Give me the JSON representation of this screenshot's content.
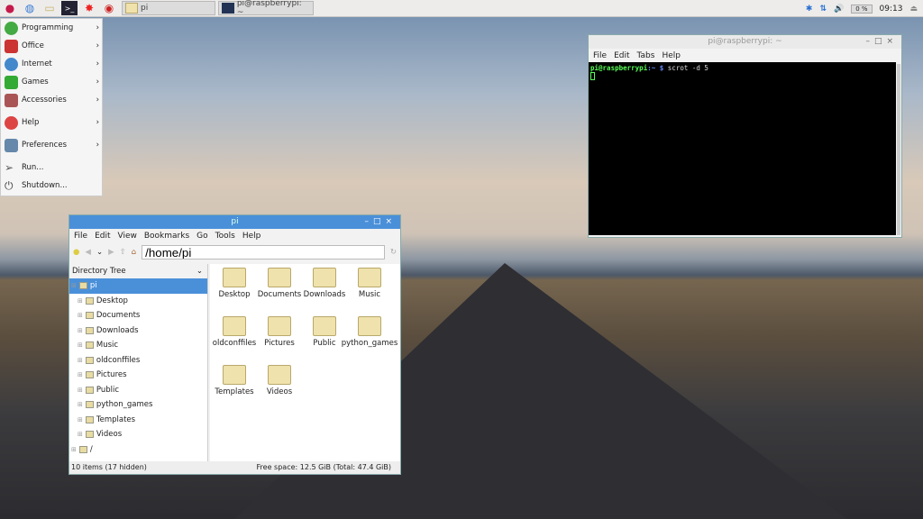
{
  "taskbar": {
    "tasks": [
      {
        "label": "pi",
        "icon": "folder-icon"
      },
      {
        "label": "pi@raspberrypi: ~",
        "icon": "terminal-icon"
      }
    ],
    "cpu": "0 %",
    "clock": "09:13"
  },
  "menu": {
    "items": [
      {
        "label": "Programming",
        "sub": true
      },
      {
        "label": "Office",
        "sub": true
      },
      {
        "label": "Internet",
        "sub": true
      },
      {
        "label": "Games",
        "sub": true
      },
      {
        "label": "Accessories",
        "sub": true
      },
      {
        "label": "Help",
        "sub": true
      },
      {
        "label": "Preferences",
        "sub": true
      },
      {
        "label": "Run..."
      },
      {
        "label": "Shutdown..."
      }
    ]
  },
  "filemanager": {
    "title": "pi",
    "menus": [
      "File",
      "Edit",
      "View",
      "Bookmarks",
      "Go",
      "Tools",
      "Help"
    ],
    "path": "/home/pi",
    "tree_header": "Directory Tree",
    "tree": [
      "pi",
      "Desktop",
      "Documents",
      "Downloads",
      "Music",
      "oldconffiles",
      "Pictures",
      "Public",
      "python_games",
      "Templates",
      "Videos",
      "/"
    ],
    "files": [
      "Desktop",
      "Documents",
      "Downloads",
      "Music",
      "oldconffiles",
      "Pictures",
      "Public",
      "python_games",
      "Templates",
      "Videos"
    ],
    "status_left": "10 items (17 hidden)",
    "status_right": "Free space: 12.5 GiB (Total: 47.4 GiB)"
  },
  "terminal": {
    "title": "pi@raspberrypi: ~",
    "menus": [
      "File",
      "Edit",
      "Tabs",
      "Help"
    ],
    "prompt_user": "pi@raspberrypi",
    "prompt_path": ":~ $",
    "command": " scrot -d 5"
  }
}
